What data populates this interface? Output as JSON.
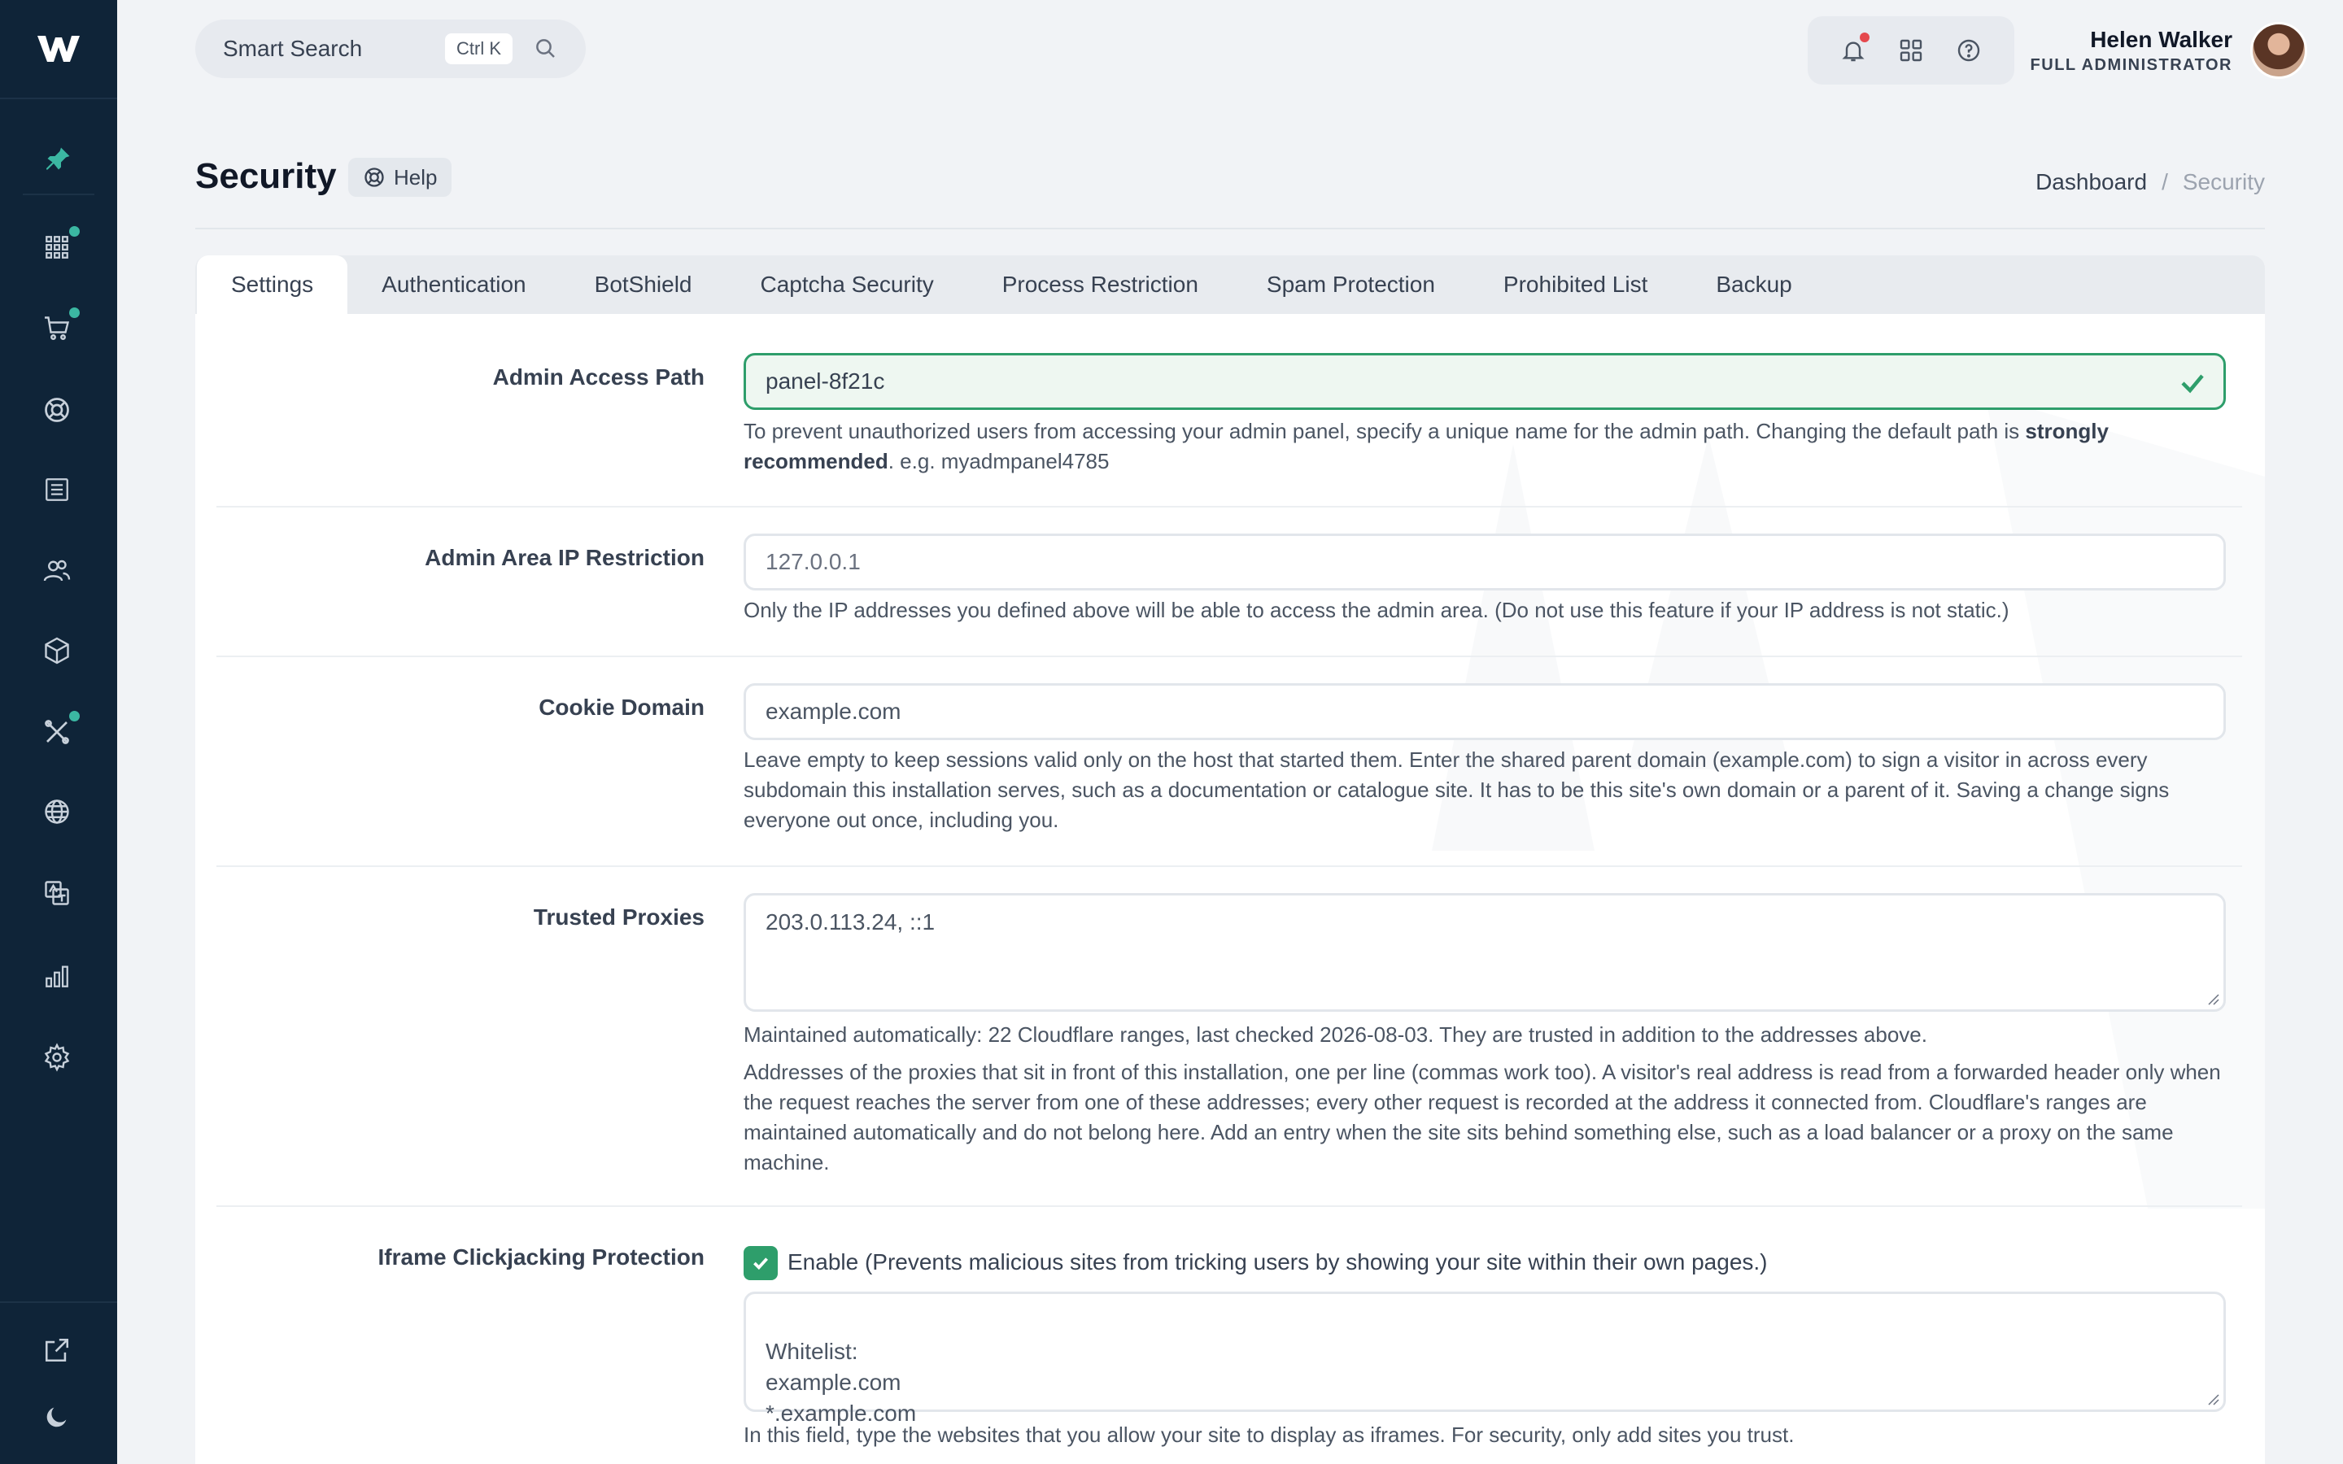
{
  "topbar": {
    "search_label": "Smart Search",
    "search_shortcut": "Ctrl K",
    "user_name": "Helen Walker",
    "user_role": "FULL ADMINISTRATOR"
  },
  "page": {
    "title": "Security",
    "help_label": "Help",
    "breadcrumb": [
      "Dashboard",
      "Security"
    ]
  },
  "tabs": [
    "Settings",
    "Authentication",
    "BotShield",
    "Captcha Security",
    "Process Restriction",
    "Spam Protection",
    "Prohibited List",
    "Backup"
  ],
  "form": {
    "admin_path": {
      "label": "Admin Access Path",
      "value": "panel-8f21c",
      "hint_before": "To prevent unauthorized users from accessing your admin panel, specify a unique name for the admin path. Changing the default path is ",
      "hint_bold": "strongly recommended",
      "hint_after": ". e.g. myadmpanel4785"
    },
    "ip_restriction": {
      "label": "Admin Area IP Restriction",
      "placeholder": "127.0.0.1",
      "hint": "Only the IP addresses you defined above will be able to access the admin area. (Do not use this feature if your IP address is not static.)"
    },
    "cookie_domain": {
      "label": "Cookie Domain",
      "placeholder": "example.com",
      "hint": "Leave empty to keep sessions valid only on the host that started them. Enter the shared parent domain (example.com) to sign a visitor in across every subdomain this installation serves, such as a documentation or catalogue site. It has to be this site's own domain or a parent of it. Saving a change signs everyone out once, including you."
    },
    "trusted_proxies": {
      "label": "Trusted Proxies",
      "value": "203.0.113.24, ::1",
      "auto_note": "Maintained automatically: 22 Cloudflare ranges, last checked 2026-08-03. They are trusted in addition to the addresses above.",
      "hint": "Addresses of the proxies that sit in front of this installation, one per line (commas work too). A visitor's real address is read from a forwarded header only when the request reaches the server from one of these addresses; every other request is recorded at the address it connected from. Cloudflare's ranges are maintained automatically and do not belong here. Add an entry when the site sits behind something else, such as a load balancer or a proxy on the same machine."
    },
    "iframe": {
      "label": "Iframe Clickjacking Protection",
      "checkbox_label": "Enable (Prevents malicious sites from tricking users by showing your site within their own pages.)",
      "checked": true,
      "whitelist_placeholder": "Whitelist:\nexample.com\n*.example.com",
      "hint": "In this field, type the websites that you allow your site to display as iframes. For security, only add sites you trust."
    }
  },
  "colors": {
    "sidebar": "#0f2438",
    "accent": "#2e9e6b",
    "badge_teal": "#3bb7a2",
    "notification_red": "#e5484d"
  }
}
